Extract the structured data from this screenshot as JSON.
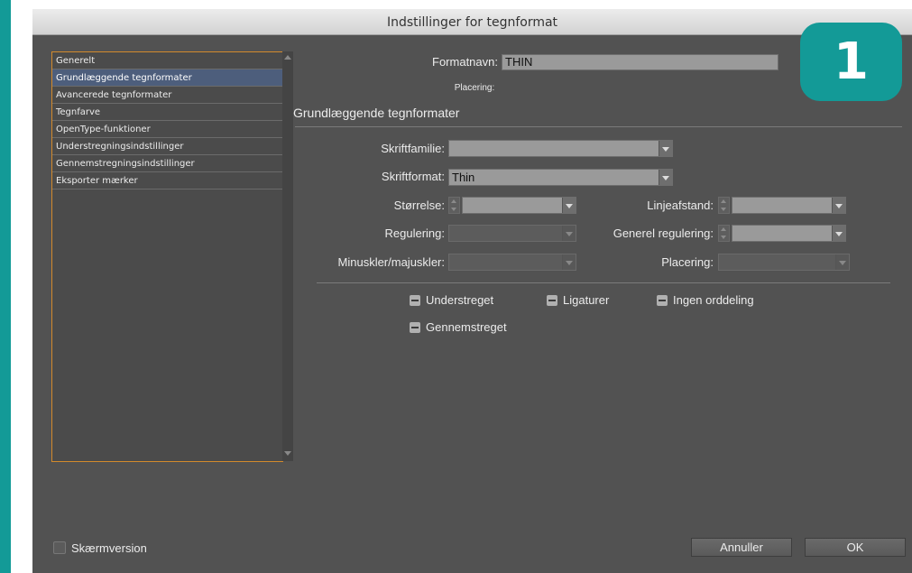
{
  "window": {
    "title": "Indstillinger for tegnformat"
  },
  "badge": {
    "text": "1",
    "color": "#139a97"
  },
  "sidebar": {
    "items": [
      {
        "label": "Generelt",
        "selected": false
      },
      {
        "label": "Grundlæggende tegnformater",
        "selected": true
      },
      {
        "label": "Avancerede tegnformater",
        "selected": false
      },
      {
        "label": "Tegnfarve",
        "selected": false
      },
      {
        "label": "OpenType-funktioner",
        "selected": false
      },
      {
        "label": "Understregningsindstillinger",
        "selected": false
      },
      {
        "label": "Gennemstregningsindstillinger",
        "selected": false
      },
      {
        "label": "Eksporter mærker",
        "selected": false
      }
    ]
  },
  "form": {
    "format_name_label": "Formatnavn:",
    "format_name_value": "THIN",
    "placement_info": "Placering:",
    "section_title": "Grundlæggende tegnformater",
    "font_family_label": "Skriftfamilie:",
    "font_family_value": "",
    "font_style_label": "Skriftformat:",
    "font_style_value": "Thin",
    "size_label": "Størrelse:",
    "size_value": "",
    "leading_label": "Linjeafstand:",
    "leading_value": "",
    "kerning_label": "Regulering:",
    "kerning_value": "",
    "tracking_label": "Generel regulering:",
    "tracking_value": "",
    "case_label": "Minuskler/majuskler:",
    "case_value": "",
    "position_label": "Placering:",
    "position_value": ""
  },
  "checkboxes": {
    "underline": "Understreget",
    "ligatures": "Ligaturer",
    "no_break": "Ingen orddeling",
    "strikethrough": "Gennemstreget"
  },
  "footer": {
    "preview_label": "Skærmversion",
    "cancel_label": "Annuller",
    "ok_label": "OK"
  }
}
